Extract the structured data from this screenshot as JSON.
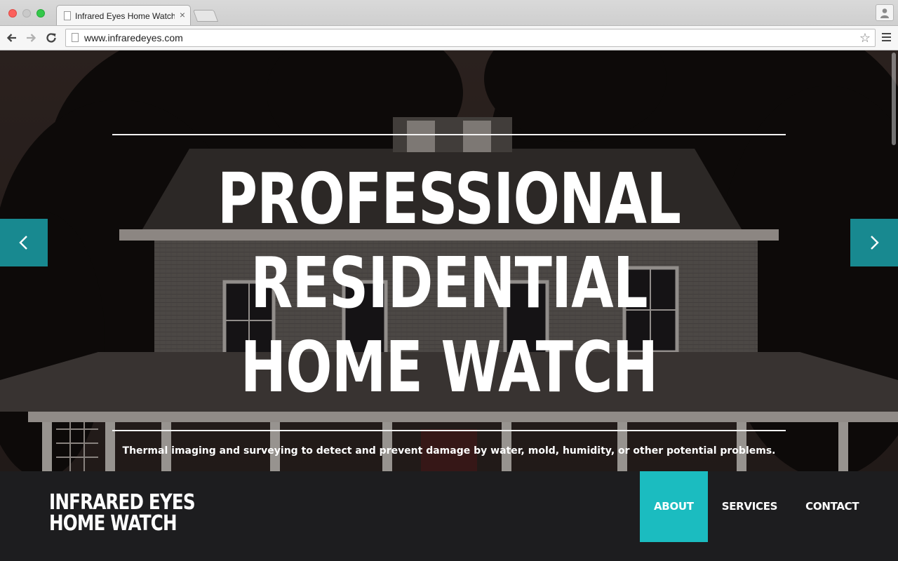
{
  "browser": {
    "tab_title": "Infrared Eyes Home Watch",
    "tab_close": "×",
    "url": "www.infraredeyes.com",
    "star": "☆"
  },
  "hero": {
    "headline": [
      "PROFESSIONAL",
      "RESIDENTIAL",
      "HOME WATCH"
    ],
    "tagline": "Thermal imaging and surveying to detect and prevent damage by water, mold, humidity, or other potential problems.",
    "accent_color": "#1bbcc0"
  },
  "site": {
    "logo": [
      "INFRARED EYES",
      "HOME WATCH"
    ],
    "nav": [
      {
        "label": "ABOUT",
        "active": true
      },
      {
        "label": "SERVICES",
        "active": false
      },
      {
        "label": "CONTACT",
        "active": false
      }
    ]
  },
  "icons": {
    "prev": "chevron-left-icon",
    "next": "chevron-right-icon",
    "back": "back-arrow-icon",
    "forward": "forward-arrow-icon",
    "reload": "reload-icon",
    "menu": "hamburger-menu-icon"
  }
}
